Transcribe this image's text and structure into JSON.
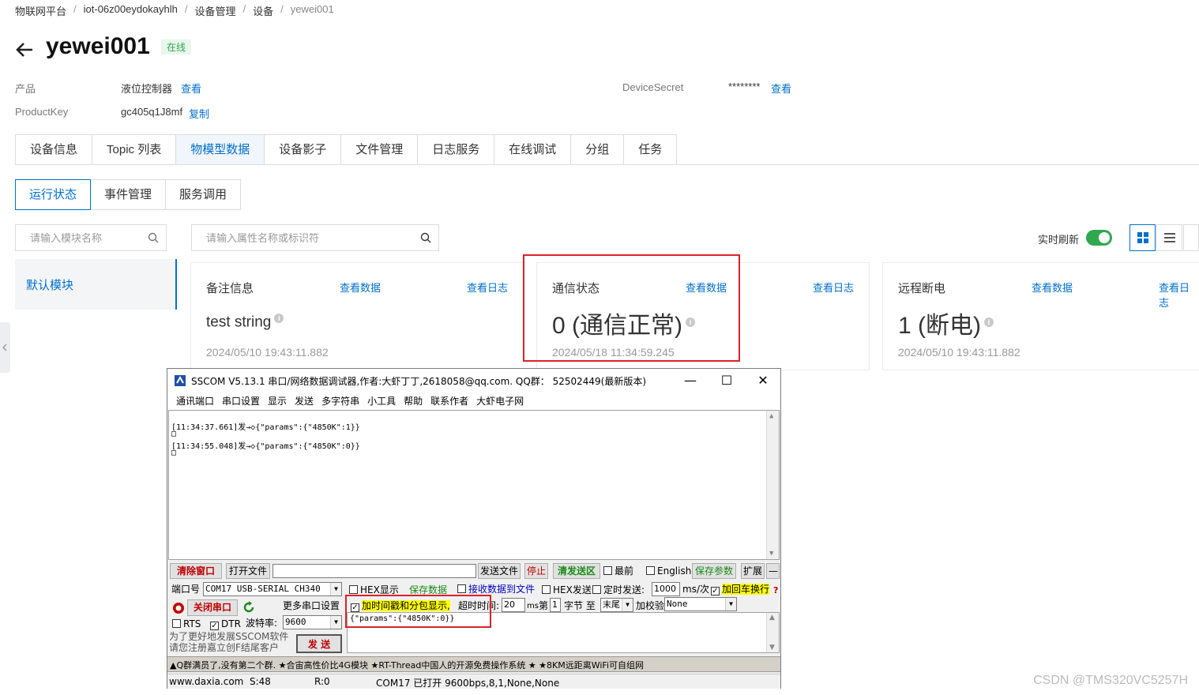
{
  "breadcrumb": [
    "物联网平台",
    "iot-06z00eydokayhlh",
    "设备管理",
    "设备",
    "yewei001"
  ],
  "device": {
    "name": "yewei001",
    "status": "在线",
    "product_label": "产品",
    "product_value": "液位控制器",
    "product_link": "查看",
    "productkey_label": "ProductKey",
    "productkey_value": "gc405q1J8mf",
    "productkey_link": "复制",
    "secret_label": "DeviceSecret",
    "secret_value": "********",
    "secret_link": "查看"
  },
  "tabs": [
    "设备信息",
    "Topic 列表",
    "物模型数据",
    "设备影子",
    "文件管理",
    "日志服务",
    "在线调试",
    "分组",
    "任务"
  ],
  "subtabs": [
    "运行状态",
    "事件管理",
    "服务调用"
  ],
  "module_search_placeholder": "请输入模块名称",
  "prop_search_placeholder": "请输入属性名称或标识符",
  "module_name": "默认模块",
  "refresh_label": "实时刷新",
  "cards": [
    {
      "title": "备注信息",
      "view_data": "查看数据",
      "view_log": "查看日志",
      "value": "test string",
      "time": "2024/05/10 19:43:11.882"
    },
    {
      "title": "通信状态",
      "view_data": "查看数据",
      "view_log": "查看日志",
      "value": "0 (通信正常)",
      "time": "2024/05/18 11:34:59.245"
    },
    {
      "title": "远程断电",
      "view_data": "查看数据",
      "view_log": "查看日志",
      "value": "1 (断电)",
      "time": "2024/05/10 19:43:11.882"
    }
  ],
  "sscom": {
    "title": "SSCOM V5.13.1 串口/网络数据调试器,作者:大虾丁丁,2618058@qq.com. QQ群： 52502449(最新版本)",
    "menu": [
      "通讯端口",
      "串口设置",
      "显示",
      "发送",
      "多字符串",
      "小工具",
      "帮助",
      "联系作者",
      "大虾电子网"
    ],
    "log": [
      "[11:34:37.661]发→◇{\"params\":{\"4850K\":1}}",
      "[11:34:55.048]发→◇{\"params\":{\"4850K\":0}}"
    ],
    "clear_btn": "清除窗口",
    "open_file_btn": "打开文件",
    "send_file_btn": "发送文件",
    "stop_btn": "停止",
    "clear_send_btn": "清发送区",
    "last_label": "最前",
    "english_label": "English",
    "save_params_btn": "保存参数",
    "expand_btn": "扩展",
    "collapse_btn": "—",
    "port_label": "端口号",
    "port_value": "COM17 USB-SERIAL CH340",
    "hex_show": "HEX显示",
    "save_data": "保存数据",
    "recv_to_file": "接收数据到文件",
    "hex_send": "HEX发送",
    "timed_send": "定时发送:",
    "interval_value": "1000",
    "interval_unit": "ms/次",
    "crlf_label": "加回车换行",
    "close_port_btn": "关闭串口",
    "more_settings_btn": "更多串口设置",
    "timestamp_label": "加时间戳和分包显示,",
    "timeout_label": "超时时间:",
    "timeout_value": "20",
    "ms_label": "ms",
    "byte_no_label": "第",
    "byte_no_value": "1",
    "byte_label": "字节 至",
    "end_value": "末尾",
    "checksum_label": "加校验",
    "checksum_value": "None",
    "rts_label": "RTS",
    "dtr_label": "DTR",
    "baud_label": "波特率:",
    "baud_value": "9600",
    "send_text": "{\"params\":{\"4850K\":0}}",
    "send_btn": "发  送",
    "promo_line1": "为了更好地发展SSCOM软件",
    "promo_line2": "请您注册嘉立创F结尾客户",
    "ticker": "▲Q群满员了,没有第二个群. ★合宙高性价比4G模块 ★RT-Thread中国人的开源免费操作系统 ★ ★8KM远距离WiFi可自组网",
    "status_site": "www.daxia.com",
    "status_s": "S:48",
    "status_r": "R:0",
    "status_port": "COM17 已打开  9600bps,8,1,None,None"
  },
  "watermark": "CSDN @TMS320VC5257H"
}
